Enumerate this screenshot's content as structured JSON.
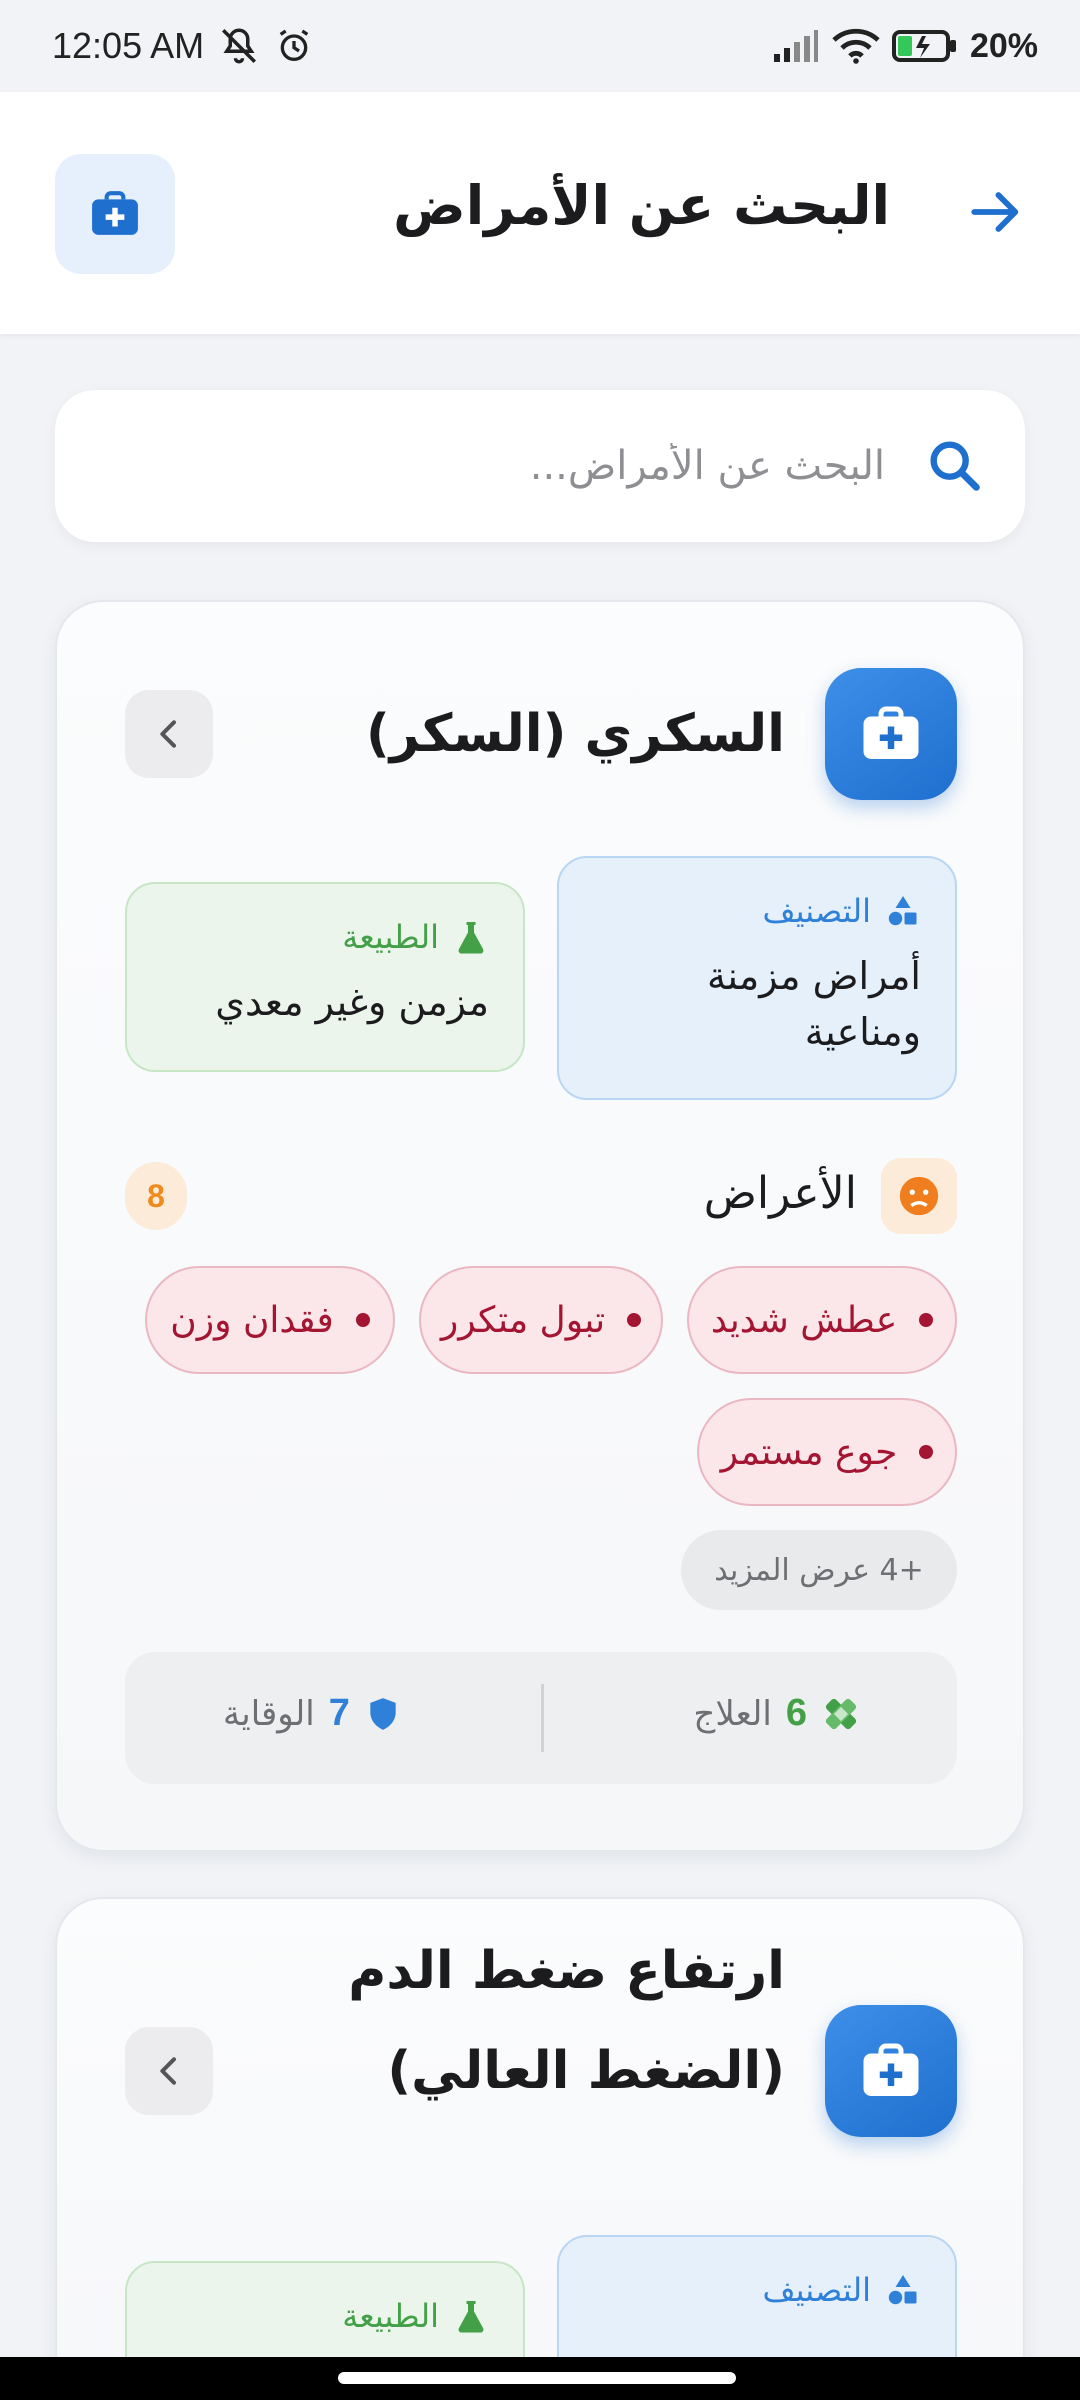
{
  "status_bar": {
    "time": "12:05 AM",
    "battery": "20%"
  },
  "header": {
    "title": "البحث عن الأمراض"
  },
  "search": {
    "placeholder": "البحث عن الأمراض..."
  },
  "labels": {
    "classification": "التصنيف",
    "nature": "الطبيعة",
    "symptoms": "الأعراض",
    "more": "+4 عرض المزيد",
    "treatment": "العلاج",
    "prevention": "الوقاية"
  },
  "diseases": [
    {
      "name": "السكري (السكر)",
      "classification": "أمراض مزمنة ومناعية",
      "nature": "مزمن وغير معدي",
      "symptom_count": "8",
      "symptoms": [
        "عطش شديد",
        "تبول متكرر",
        "فقدان وزن",
        "جوع مستمر"
      ],
      "treatment_count": "6",
      "prevention_count": "7"
    },
    {
      "name": "ارتفاع ضغط الدم (الضغط العالي)"
    }
  ],
  "colors": {
    "primary": "#2f80d8",
    "nature_green": "#43a047",
    "symptom_red": "#a31530",
    "badge_orange": "#f08a1c"
  },
  "icons": [
    "medical-kit-icon",
    "back-arrow-icon",
    "search-icon",
    "chevron-left-icon",
    "shapes-icon",
    "flask-icon",
    "sick-face-icon",
    "bandage-icon",
    "shield-icon"
  ]
}
